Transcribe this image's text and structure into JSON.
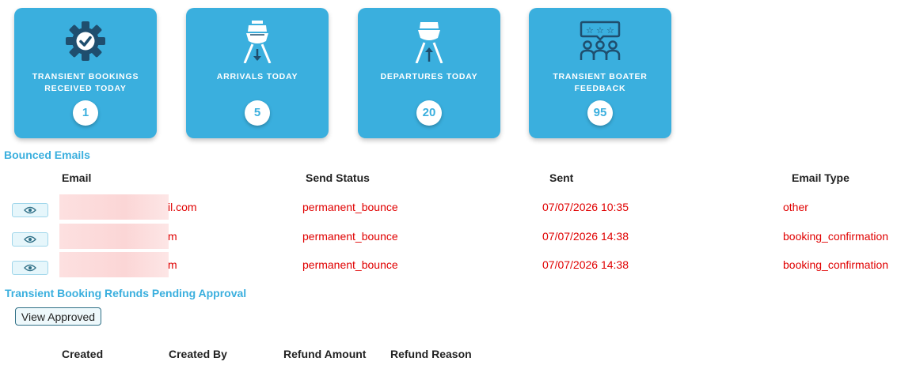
{
  "cards": [
    {
      "label": "Transient Bookings Received Today",
      "count": "1",
      "icon": "gear-check-icon"
    },
    {
      "label": "Arrivals Today",
      "count": "5",
      "icon": "boat-arrival-icon"
    },
    {
      "label": "Departures Today",
      "count": "20",
      "icon": "boat-departure-icon"
    },
    {
      "label": "Transient Boater Feedback",
      "count": "95",
      "icon": "feedback-stars-icon"
    }
  ],
  "bounced": {
    "title": "Bounced Emails",
    "headers": {
      "email": "Email",
      "status": "Send Status",
      "sent": "Sent",
      "type": "Email Type"
    },
    "rows": [
      {
        "email": "il.com",
        "status": "permanent_bounce",
        "sent": "07/07/2026 10:35",
        "type": "other"
      },
      {
        "email": "m",
        "status": "permanent_bounce",
        "sent": "07/07/2026 14:38",
        "type": "booking_confirmation"
      },
      {
        "email": "m",
        "status": "permanent_bounce",
        "sent": "07/07/2026 14:38",
        "type": "booking_confirmation"
      }
    ],
    "text_color": "#e00000"
  },
  "refunds": {
    "title": "Transient Booking Refunds Pending Approval",
    "view_approved_label": "View Approved",
    "headers": {
      "created": "Created",
      "created_by": "Created By",
      "amount": "Refund Amount",
      "reason": "Refund Reason"
    }
  },
  "colors": {
    "accent": "#3aafde",
    "card_icon_dark": "#1f4e6e"
  }
}
